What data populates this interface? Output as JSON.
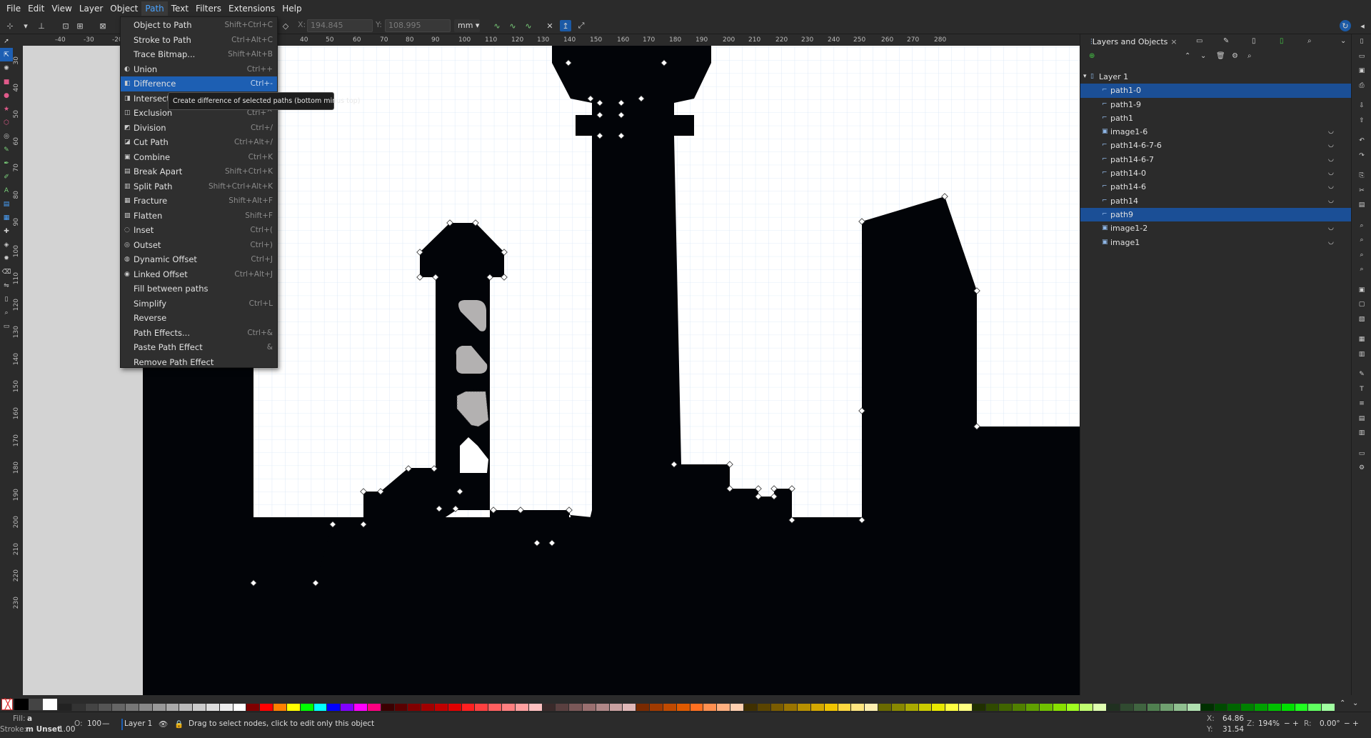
{
  "menubar": {
    "items": [
      "File",
      "Edit",
      "View",
      "Layer",
      "Object",
      "Path",
      "Text",
      "Filters",
      "Extensions",
      "Help"
    ],
    "active_index": 5
  },
  "toolbar": {
    "x_label": "X:",
    "x_value": "194.845",
    "y_label": "Y:",
    "y_value": "108.995",
    "unit": "mm"
  },
  "path_menu": {
    "items": [
      {
        "label": "Object to Path",
        "shortcut": "Shift+Ctrl+C",
        "icon": ""
      },
      {
        "label": "Stroke to Path",
        "shortcut": "Ctrl+Alt+C",
        "icon": ""
      },
      {
        "label": "Trace Bitmap...",
        "shortcut": "Shift+Alt+B",
        "icon": ""
      },
      {
        "label": "Union",
        "shortcut": "Ctrl++",
        "icon": "union-icon"
      },
      {
        "label": "Difference",
        "shortcut": "Ctrl+-",
        "icon": "difference-icon"
      },
      {
        "label": "Intersection",
        "shortcut": "Ctrl+*",
        "icon": "intersection-icon"
      },
      {
        "label": "Exclusion",
        "shortcut": "Ctrl+^",
        "icon": "exclusion-icon"
      },
      {
        "label": "Division",
        "shortcut": "Ctrl+/",
        "icon": "division-icon"
      },
      {
        "label": "Cut Path",
        "shortcut": "Ctrl+Alt+/",
        "icon": "cut-path-icon"
      },
      {
        "label": "Combine",
        "shortcut": "Ctrl+K",
        "icon": "combine-icon"
      },
      {
        "label": "Break Apart",
        "shortcut": "Shift+Ctrl+K",
        "icon": "break-apart-icon"
      },
      {
        "label": "Split Path",
        "shortcut": "Shift+Ctrl+Alt+K",
        "icon": "split-path-icon"
      },
      {
        "label": "Fracture",
        "shortcut": "Shift+Alt+F",
        "icon": "fracture-icon"
      },
      {
        "label": "Flatten",
        "shortcut": "Shift+F",
        "icon": "flatten-icon"
      },
      {
        "label": "Inset",
        "shortcut": "Ctrl+(",
        "icon": "inset-icon"
      },
      {
        "label": "Outset",
        "shortcut": "Ctrl+)",
        "icon": "outset-icon"
      },
      {
        "label": "Dynamic Offset",
        "shortcut": "Ctrl+J",
        "icon": "dynamic-offset-icon"
      },
      {
        "label": "Linked Offset",
        "shortcut": "Ctrl+Alt+J",
        "icon": "linked-offset-icon"
      },
      {
        "label": "Fill between paths",
        "shortcut": "",
        "icon": ""
      },
      {
        "label": "Simplify",
        "shortcut": "Ctrl+L",
        "icon": ""
      },
      {
        "label": "Reverse",
        "shortcut": "",
        "icon": ""
      },
      {
        "label": "Path Effects...",
        "shortcut": "Ctrl+&",
        "icon": ""
      },
      {
        "label": "Paste Path Effect",
        "shortcut": "&",
        "icon": ""
      },
      {
        "label": "Remove Path Effect",
        "shortcut": "",
        "icon": ""
      }
    ],
    "selected_index": 4
  },
  "tooltip": "Create difference of selected paths (bottom minus top)",
  "rulers": {
    "top": [
      "-40",
      "-30",
      "-20",
      "40",
      "50",
      "60",
      "70",
      "80",
      "90",
      "100",
      "110",
      "120",
      "130",
      "140",
      "150",
      "160",
      "170",
      "180",
      "190",
      "200",
      "210",
      "220",
      "230",
      "240",
      "250",
      "260",
      "270",
      "280"
    ],
    "left": [
      "30",
      "40",
      "50",
      "60",
      "70",
      "80",
      "90",
      "100",
      "110",
      "120",
      "130",
      "140",
      "150",
      "160",
      "170",
      "180",
      "190",
      "200",
      "210",
      "220",
      "230"
    ]
  },
  "layers_panel": {
    "tab_title": "Layers and Objects",
    "rows": [
      {
        "label": "Layer 1",
        "kind": "layer",
        "selected": false,
        "visible_toggle": false
      },
      {
        "label": "path1-0",
        "kind": "path",
        "selected": true,
        "visible_toggle": false
      },
      {
        "label": "path1-9",
        "kind": "path",
        "selected": false,
        "visible_toggle": false
      },
      {
        "label": "path1",
        "kind": "path",
        "selected": false,
        "visible_toggle": false
      },
      {
        "label": "image1-6",
        "kind": "image",
        "selected": false,
        "visible_toggle": true
      },
      {
        "label": "path14-6-7-6",
        "kind": "path",
        "selected": false,
        "visible_toggle": true
      },
      {
        "label": "path14-6-7",
        "kind": "path",
        "selected": false,
        "visible_toggle": true
      },
      {
        "label": "path14-0",
        "kind": "path",
        "selected": false,
        "visible_toggle": true
      },
      {
        "label": "path14-6",
        "kind": "path",
        "selected": false,
        "visible_toggle": true
      },
      {
        "label": "path14",
        "kind": "path",
        "selected": false,
        "visible_toggle": true
      },
      {
        "label": "path9",
        "kind": "path",
        "selected": true,
        "visible_toggle": false
      },
      {
        "label": "image1-2",
        "kind": "image",
        "selected": false,
        "visible_toggle": true
      },
      {
        "label": "image1",
        "kind": "image",
        "selected": false,
        "visible_toggle": true
      }
    ]
  },
  "statusbar": {
    "fill_label": "Fill:",
    "fill_value": "a",
    "stroke_label": "Stroke:",
    "stroke_value": "m Unset",
    "stroke_width": "1.00",
    "opacity_label": "O:",
    "opacity_value": "100",
    "layer": "Layer 1",
    "message": "Drag to select nodes, click to edit only this object",
    "x_label": "X:",
    "x_value": "64.86",
    "y_label": "Y:",
    "y_value": "31.54",
    "zoom_label": "Z:",
    "zoom_value": "194%",
    "rotation_label": "R:",
    "rotation_value": "0.00°"
  },
  "colors": {
    "accent": "#1d5fb3",
    "canvas_bg": "#ffffff",
    "shape_fill": "#020408",
    "hole_fill": "#b3b1b1",
    "grid": "#bfd6ee"
  }
}
